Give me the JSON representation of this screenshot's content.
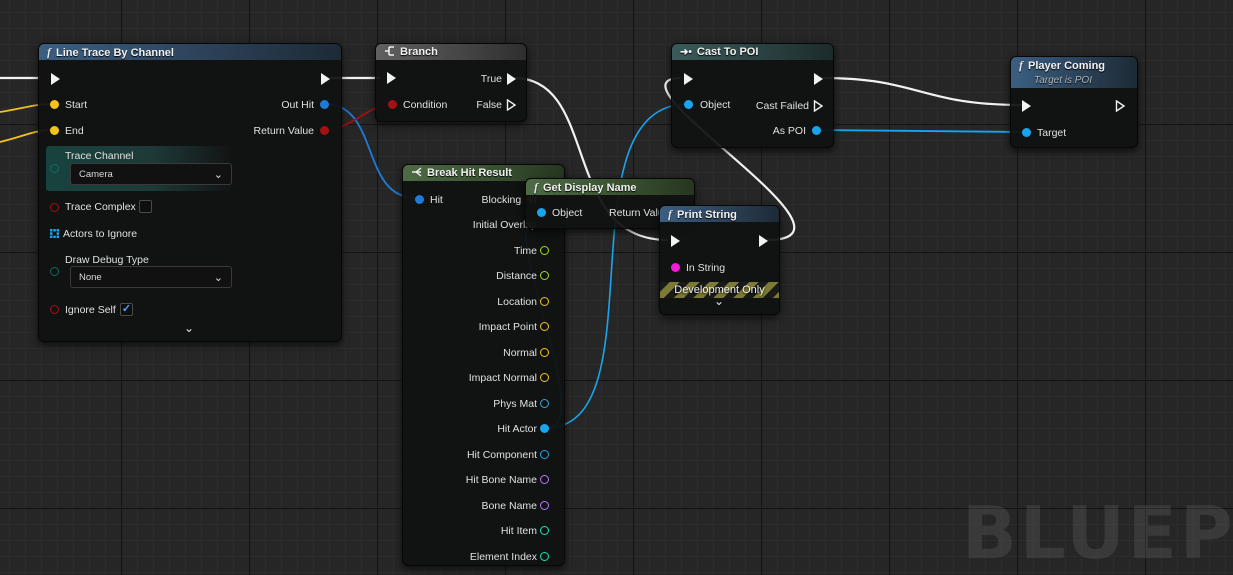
{
  "watermark": "BLUEPRI",
  "colors": {
    "exec": "#f2f2f2",
    "vector": "#f4c31a",
    "bool": "#a31212",
    "object": "#19a5ee",
    "float": "#a1e01c",
    "struct": "#1e7bd9",
    "string": "#f41cd7",
    "name": "#b47aff",
    "int": "#1fe3b1",
    "enum": "#0e6b62",
    "material": "#3aa4d9"
  },
  "nodes": {
    "line_trace": {
      "title": "Line Trace By Channel",
      "icon": "function-icon",
      "pins": {
        "start": "Start",
        "end": "End",
        "trace_channel": "Trace Channel",
        "trace_complex": "Trace Complex",
        "actors_to_ignore": "Actors to Ignore",
        "draw_debug_type": "Draw Debug Type",
        "ignore_self": "Ignore Self",
        "out_hit": "Out Hit",
        "return_value": "Return Value"
      },
      "trace_channel_value": "Camera",
      "draw_debug_value": "None",
      "trace_complex_checked": false,
      "ignore_self_checked": true,
      "checkmark": "✓"
    },
    "branch": {
      "title": "Branch",
      "icon": "branch-icon",
      "pins": {
        "condition": "Condition",
        "true": "True",
        "false": "False"
      }
    },
    "cast": {
      "title": "Cast To POI",
      "icon": "cast-icon",
      "pins": {
        "object": "Object",
        "cast_failed": "Cast Failed",
        "as_poi": "As POI"
      }
    },
    "player_coming": {
      "title": "Player Coming",
      "subtitle": "Target is POI",
      "icon": "function-icon",
      "pins": {
        "target": "Target"
      }
    },
    "break_hit": {
      "title": "Break Hit Result",
      "icon": "break-struct-icon",
      "pins": {
        "hit": "Hit",
        "outputs": [
          "Blocking Hit",
          "Initial Overlap",
          "Time",
          "Distance",
          "Location",
          "Impact Point",
          "Normal",
          "Impact Normal",
          "Phys Mat",
          "Hit Actor",
          "Hit Component",
          "Hit Bone Name",
          "Bone Name",
          "Hit Item",
          "Element Index"
        ]
      }
    },
    "get_display_name": {
      "title": "Get Display Name",
      "icon": "function-icon",
      "pins": {
        "object": "Object",
        "return_value": "Return Value"
      }
    },
    "print_string": {
      "title": "Print String",
      "icon": "function-icon",
      "pins": {
        "in_string": "In String"
      },
      "dev_banner": "Development Only"
    }
  }
}
